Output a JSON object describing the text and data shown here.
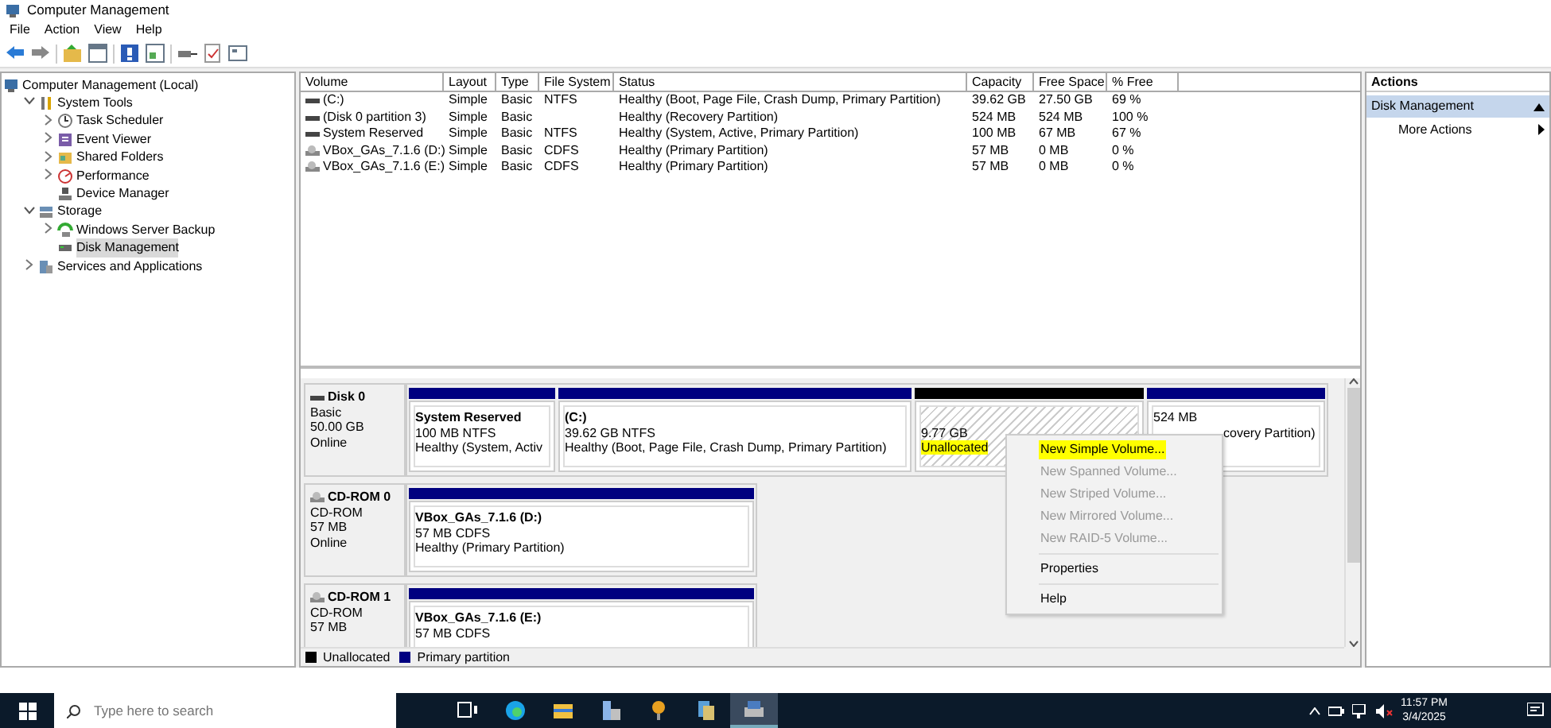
{
  "window": {
    "title": "Computer Management"
  },
  "menu": [
    "File",
    "Action",
    "View",
    "Help"
  ],
  "tree": [
    {
      "label": "Computer Management (Local)",
      "children": [
        {
          "label": "System Tools",
          "expanded": true,
          "children": [
            {
              "label": "Task Scheduler",
              "expandable": true,
              "selected": false
            },
            {
              "label": "Event Viewer",
              "expandable": true,
              "selected": false
            },
            {
              "label": "Shared Folders",
              "expandable": true,
              "selected": false
            },
            {
              "label": "Performance",
              "expandable": true,
              "selected": false
            },
            {
              "label": "Device Manager",
              "expandable": false,
              "selected": false
            }
          ]
        },
        {
          "label": "Storage",
          "expanded": true,
          "children": [
            {
              "label": "Windows Server Backup",
              "expandable": true,
              "selected": false
            },
            {
              "label": "Disk Management",
              "expandable": false,
              "selected": true
            }
          ]
        },
        {
          "label": "Services and Applications",
          "expanded": false
        }
      ]
    }
  ],
  "volumes": {
    "columns": [
      "Volume",
      "Layout",
      "Type",
      "File System",
      "Status",
      "Capacity",
      "Free Space",
      "% Free"
    ],
    "rows": [
      {
        "kind": "disk",
        "cells": [
          " (C:)",
          "Simple",
          "Basic",
          "NTFS",
          "Healthy (Boot, Page File, Crash Dump, Primary Partition)",
          "39.62 GB",
          "27.50 GB",
          "69 %"
        ]
      },
      {
        "kind": "disk",
        "cells": [
          "(Disk 0 partition 3)",
          "Simple",
          "Basic",
          "",
          "Healthy (Recovery Partition)",
          "524 MB",
          "524 MB",
          "100 %"
        ]
      },
      {
        "kind": "disk",
        "cells": [
          "System Reserved",
          "Simple",
          "Basic",
          "NTFS",
          "Healthy (System, Active, Primary Partition)",
          "100 MB",
          "67 MB",
          "67 %"
        ]
      },
      {
        "kind": "cd",
        "cells": [
          "VBox_GAs_7.1.6 (D:)",
          "Simple",
          "Basic",
          "CDFS",
          "Healthy (Primary Partition)",
          "57 MB",
          "0 MB",
          "0 %"
        ]
      },
      {
        "kind": "cd",
        "cells": [
          "VBox_GAs_7.1.6 (E:)",
          "Simple",
          "Basic",
          "CDFS",
          "Healthy (Primary Partition)",
          "57 MB",
          "0 MB",
          "0 %"
        ]
      }
    ]
  },
  "disks": [
    {
      "kind": "disk",
      "name": "Disk 0",
      "lines": [
        "Basic",
        "50.00 GB",
        "Online"
      ],
      "partitions": [
        {
          "kind": "primary",
          "title": "System Reserved",
          "lines": [
            "100 MB NTFS",
            "Healthy (System, Activ"
          ]
        },
        {
          "kind": "primary",
          "title": "(C:)",
          "lines": [
            "39.62 GB NTFS",
            "Healthy (Boot, Page File, Crash Dump, Primary Partition)"
          ]
        },
        {
          "kind": "unallocated",
          "lines": [
            "9.77 GB"
          ],
          "label": "Unallocated",
          "highlighted": true
        },
        {
          "kind": "primary",
          "lines": [
            "524 MB",
            "covery Partition)"
          ],
          "covered": true
        }
      ]
    },
    {
      "kind": "cd",
      "name": "CD-ROM 0",
      "lines": [
        "CD-ROM",
        "57 MB",
        "Online"
      ],
      "partitions": [
        {
          "kind": "primary",
          "title": "VBox_GAs_7.1.6  (D:)",
          "lines": [
            "57 MB CDFS",
            "Healthy (Primary Partition)"
          ]
        }
      ]
    },
    {
      "kind": "cd",
      "name": "CD-ROM 1",
      "lines": [
        "CD-ROM",
        "57 MB"
      ],
      "partitions": [
        {
          "kind": "primary",
          "title": "VBox_GAs_7.1.6  (E:)",
          "lines": [
            "57 MB CDFS"
          ]
        }
      ]
    }
  ],
  "legend": [
    {
      "label": "Unallocated",
      "color": "#000000"
    },
    {
      "label": "Primary partition",
      "color": "#000080"
    }
  ],
  "context_menu": [
    {
      "kind": "item",
      "label": "New Simple Volume...",
      "disabled": false,
      "highlighted": true
    },
    {
      "kind": "item",
      "label": "New Spanned Volume...",
      "disabled": true,
      "highlighted": false
    },
    {
      "kind": "item",
      "label": "New Striped Volume...",
      "disabled": true,
      "highlighted": false
    },
    {
      "kind": "item",
      "label": "New Mirrored Volume...",
      "disabled": true,
      "highlighted": false
    },
    {
      "kind": "item",
      "label": "New RAID-5 Volume...",
      "disabled": true,
      "highlighted": false
    },
    {
      "kind": "separator"
    },
    {
      "kind": "item",
      "label": "Properties",
      "disabled": false,
      "highlighted": false
    },
    {
      "kind": "separator"
    },
    {
      "kind": "item",
      "label": "Help",
      "disabled": false,
      "highlighted": false
    }
  ],
  "actions": {
    "title": "Actions",
    "section": "Disk Management",
    "items": [
      "More Actions"
    ]
  },
  "taskbar": {
    "search_placeholder": "Type here to search",
    "apps": [
      {
        "kind": "taskview",
        "selected": false
      },
      {
        "kind": "edge",
        "selected": false
      },
      {
        "kind": "explorer",
        "selected": false
      },
      {
        "kind": "server",
        "selected": false
      },
      {
        "kind": "tool",
        "selected": false
      },
      {
        "kind": "files",
        "selected": false
      },
      {
        "kind": "diskmgmt",
        "selected": true
      }
    ],
    "time": "11:57 PM",
    "date": "3/4/2025"
  }
}
